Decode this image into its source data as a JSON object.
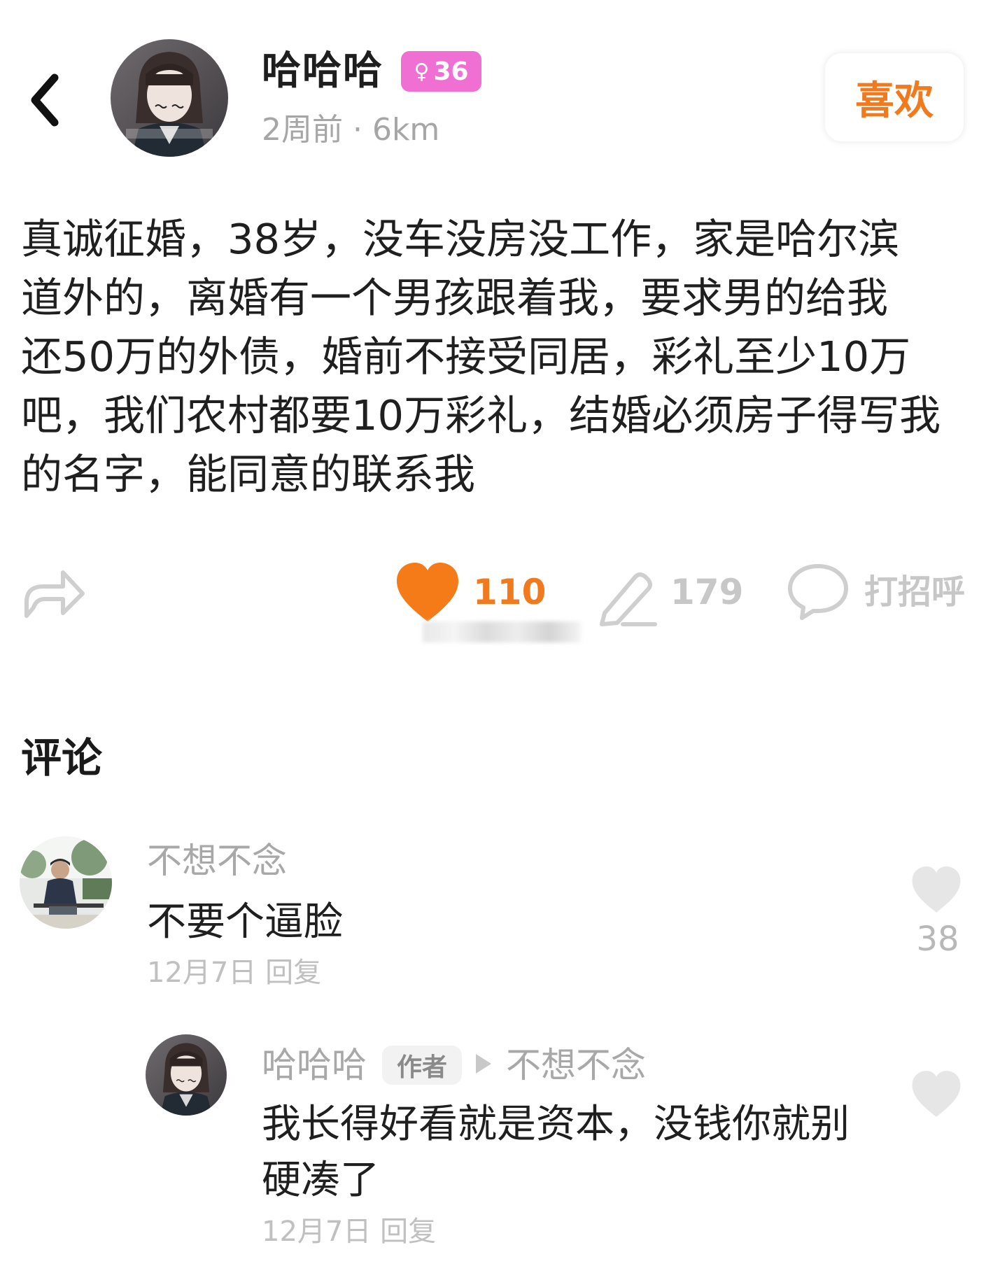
{
  "post": {
    "username": "哈哈哈",
    "badge": {
      "symbol": "♀",
      "age": "36",
      "color": "#f06fd3"
    },
    "meta": "2周前 · 6km",
    "like_button_label": "喜欢",
    "text_lines": [
      "真诚征婚，38岁，没车没房没工作，家是哈尔滨",
      "道外的，离婚有一个男孩跟着我，要求男的给我",
      "还50万的外债，婚前不接受同居，彩礼至少10万",
      "吧，我们农村都要10万彩礼，结婚必须房子得写我",
      "的名字，能同意的联系我"
    ]
  },
  "actions": {
    "likes_count": "110",
    "comments_count": "179",
    "greet_label": "打招呼",
    "accent_color": "#f07a1d"
  },
  "comments": {
    "section_title": "评论",
    "items": [
      {
        "username": "不想不念",
        "text": "不要个逼脸",
        "date": "12月7日",
        "reply_label": "回复",
        "likes": "38"
      }
    ],
    "reply": {
      "username": "哈哈哈",
      "author_tag": "作者",
      "reply_to": "不想不念",
      "text_lines": [
        "我长得好看就是资本，没钱你就别",
        "硬凑了"
      ],
      "date": "12月7日",
      "reply_label": "回复"
    }
  },
  "icons": {
    "back": "chevron-left-icon",
    "share": "share-arrow-icon",
    "like": "heart-icon",
    "comment": "pencil-icon",
    "greet": "chat-bubble-icon"
  }
}
